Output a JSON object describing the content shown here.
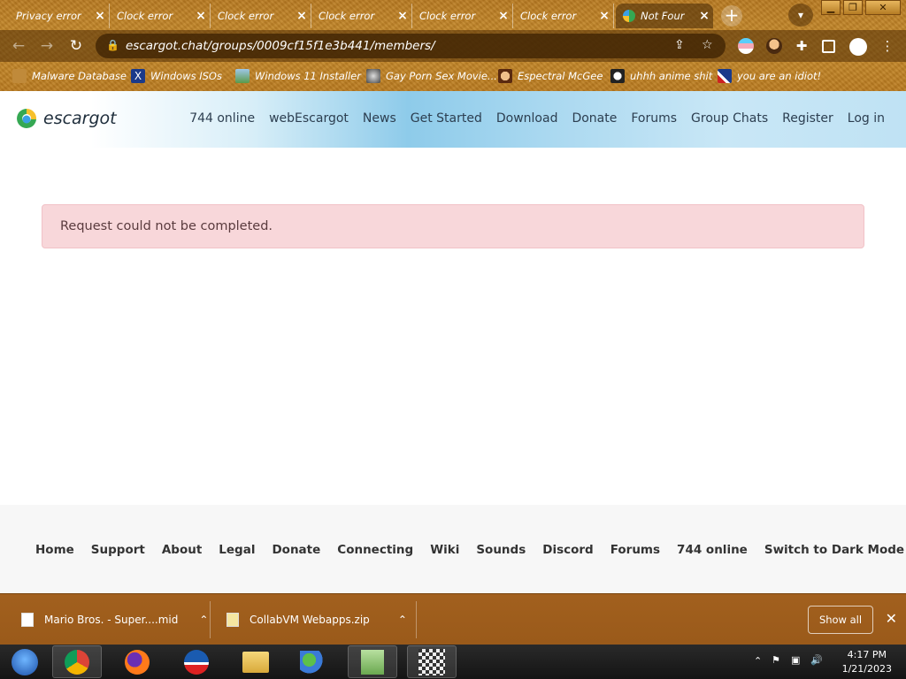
{
  "browser": {
    "tabs": [
      {
        "label": "Privacy error",
        "active": false
      },
      {
        "label": "Clock error",
        "active": false
      },
      {
        "label": "Clock error",
        "active": false
      },
      {
        "label": "Clock error",
        "active": false
      },
      {
        "label": "Clock error",
        "active": false
      },
      {
        "label": "Clock error",
        "active": false
      },
      {
        "label": "Not Four",
        "active": true
      }
    ],
    "new_tab_glyph": "+",
    "url": "escargot.chat/groups/0009cf15f1e3b441/members/",
    "bookmarks": [
      {
        "label": "Malware Database",
        "icon": "folder-icon"
      },
      {
        "label": "Windows ISOs",
        "icon": "x-icon"
      },
      {
        "label": "Windows 11 Installer",
        "icon": "image-icon"
      },
      {
        "label": "Gay Porn Sex Movie...",
        "icon": "globe-icon"
      },
      {
        "label": "Espectral McGee",
        "icon": "avatar-icon"
      },
      {
        "label": "uhhh anime shit",
        "icon": "anime-icon"
      },
      {
        "label": "you are an idiot!",
        "icon": "flag-icon"
      }
    ]
  },
  "site": {
    "logo_text": "escargot",
    "nav": [
      "744 online",
      "webEscargot",
      "News",
      "Get Started",
      "Download",
      "Donate",
      "Forums",
      "Group Chats",
      "Register",
      "Log in"
    ],
    "alert": "Request could not be completed.",
    "footer_nav": [
      "Home",
      "Support",
      "About",
      "Legal",
      "Donate",
      "Connecting",
      "Wiki",
      "Sounds",
      "Discord",
      "Forums",
      "744 online",
      "Switch to Dark Mode"
    ]
  },
  "downloads": {
    "items": [
      {
        "name": "Mario Bros. - Super....mid"
      },
      {
        "name": "CollabVM Webapps.zip"
      }
    ],
    "show_all": "Show all"
  },
  "taskbar": {
    "time": "4:17 PM",
    "date": "1/21/2023"
  },
  "colors": {
    "chrome_brown": "#b87a22",
    "alert_bg": "#f8d7da",
    "header_blue": "#8ecbea"
  }
}
